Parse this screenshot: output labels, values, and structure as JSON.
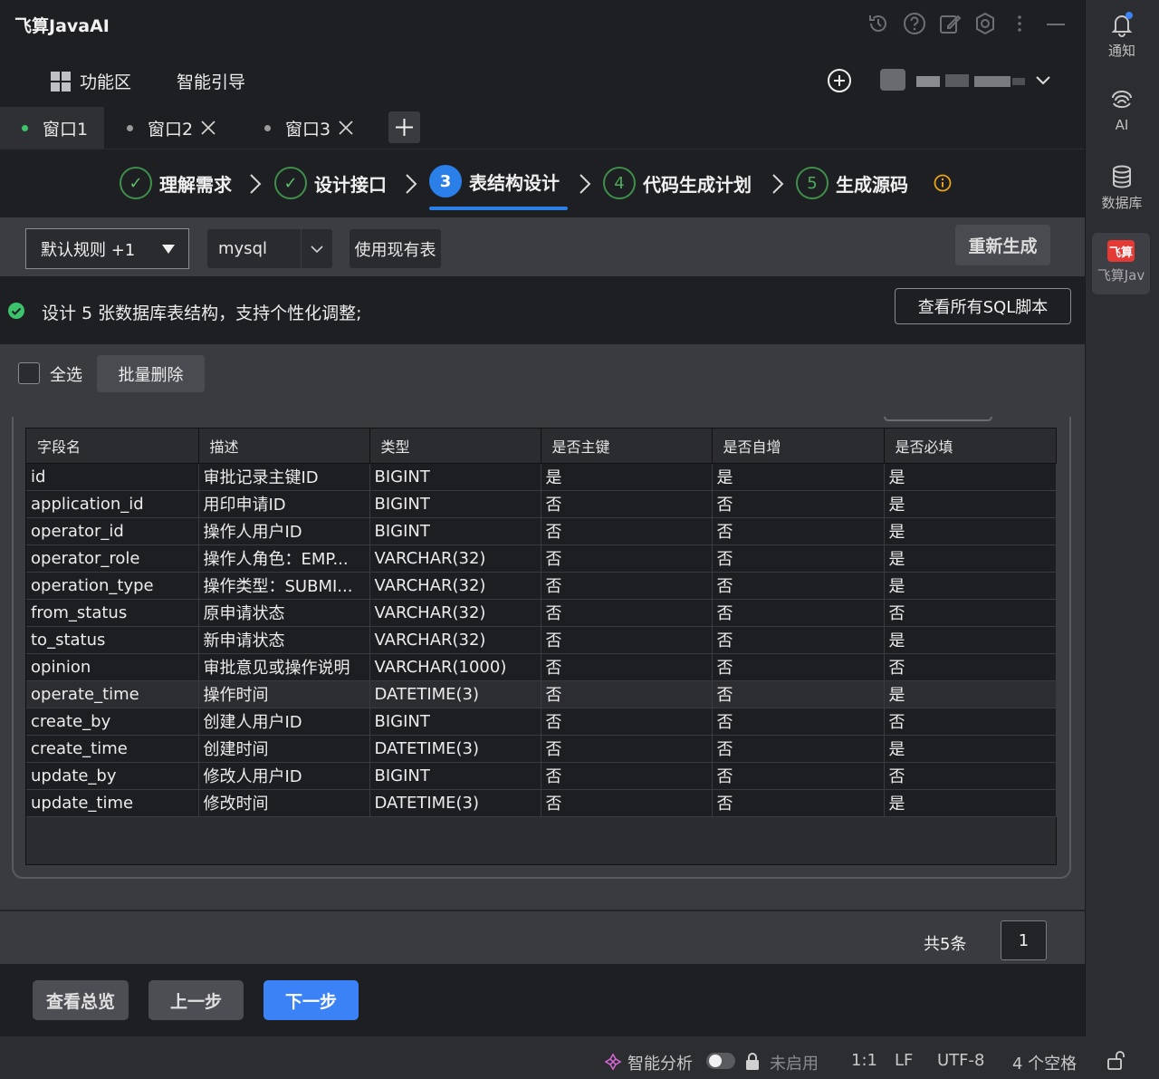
{
  "app": {
    "title": "飞算JavaAI"
  },
  "menu": {
    "function_area": "功能区",
    "smart_guide": "智能引导"
  },
  "tabs": [
    {
      "label": "窗口1",
      "dot_color": "#3cc36b"
    },
    {
      "label": "窗口2",
      "dot_color": "#9a9a9a"
    },
    {
      "label": "窗口3",
      "dot_color": "#9a9a9a"
    }
  ],
  "steps": [
    {
      "num": "✓",
      "label": "理解需求",
      "state": "done"
    },
    {
      "num": "✓",
      "label": "设计接口",
      "state": "done"
    },
    {
      "num": "3",
      "label": "表结构设计",
      "state": "active"
    },
    {
      "num": "4",
      "label": "代码生成计划",
      "state": "todo"
    },
    {
      "num": "5",
      "label": "生成源码",
      "state": "todo"
    }
  ],
  "options": {
    "rule": "默认规则 +1",
    "db": "mysql",
    "use_existing": "使用现有表",
    "regenerate": "重新生成"
  },
  "info": {
    "text": "设计 5 张数据库表结构，支持个性化调整;",
    "view_sql": "查看所有SQL脚本"
  },
  "toolbar": {
    "select_all": "全选",
    "batch_delete": "批量删除"
  },
  "table": {
    "headers": [
      "字段名",
      "描述",
      "类型",
      "是否主键",
      "是否自增",
      "是否必填"
    ],
    "rows": [
      [
        "id",
        "审批记录主键ID",
        "BIGINT",
        "是",
        "是",
        "是"
      ],
      [
        "application_id",
        "用印申请ID",
        "BIGINT",
        "否",
        "否",
        "是"
      ],
      [
        "operator_id",
        "操作人用户ID",
        "BIGINT",
        "否",
        "否",
        "是"
      ],
      [
        "operator_role",
        "操作人角色：EMP...",
        "VARCHAR(32)",
        "否",
        "否",
        "是"
      ],
      [
        "operation_type",
        "操作类型：SUBMI...",
        "VARCHAR(32)",
        "否",
        "否",
        "是"
      ],
      [
        "from_status",
        "原申请状态",
        "VARCHAR(32)",
        "否",
        "否",
        "否"
      ],
      [
        "to_status",
        "新申请状态",
        "VARCHAR(32)",
        "否",
        "否",
        "是"
      ],
      [
        "opinion",
        "审批意见或操作说明",
        "VARCHAR(1000)",
        "否",
        "否",
        "否"
      ],
      [
        "operate_time",
        "操作时间",
        "DATETIME(3)",
        "否",
        "否",
        "是"
      ],
      [
        "create_by",
        "创建人用户ID",
        "BIGINT",
        "否",
        "否",
        "否"
      ],
      [
        "create_time",
        "创建时间",
        "DATETIME(3)",
        "否",
        "否",
        "是"
      ],
      [
        "update_by",
        "修改人用户ID",
        "BIGINT",
        "否",
        "否",
        "否"
      ],
      [
        "update_time",
        "修改时间",
        "DATETIME(3)",
        "否",
        "否",
        "是"
      ]
    ],
    "highlighted_row": 8
  },
  "pager": {
    "total": "共5条",
    "page": "1"
  },
  "footer": {
    "overview": "查看总览",
    "prev": "上一步",
    "next": "下一步"
  },
  "status": {
    "smart_analysis": "智能分析",
    "disabled": "未启用",
    "position": "1:1",
    "line_ending": "LF",
    "encoding": "UTF-8",
    "indent": "4 个空格"
  },
  "sidebar": {
    "notify": "通知",
    "ai": "AI",
    "database": "数据库",
    "feisuan": "飞算Jav",
    "feisuan_logo_text": "飞算"
  },
  "colors": {
    "accent_blue": "#2a7fe8",
    "success_green": "#3cc36b",
    "warning_orange": "#e8a317",
    "brand_red": "#e53935"
  }
}
